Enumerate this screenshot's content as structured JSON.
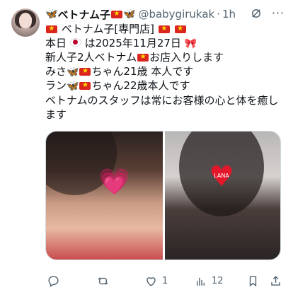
{
  "tweet": {
    "display_name": "ベトナム子",
    "handle": "@babygirukak",
    "separator": "·",
    "time": "1h",
    "lines": [
      "ベトナム子[専門店]",
      "本日",
      "は2025年11月27日",
      "新人子2人ベトナム",
      "お店入りします",
      "みさ",
      "ちゃん21歳 本人です",
      "ラン",
      "ちゃん22歳本人です",
      "ベトナムのスタッフは常にお客様の心と体を癒します"
    ],
    "heart_label": "LANA"
  },
  "actions": {
    "reply_count": "",
    "retweet_count": "",
    "like_count": "1",
    "views_count": "12"
  },
  "icons": {
    "grok": "grok-icon",
    "more": "more-icon",
    "reply": "reply-icon",
    "retweet": "retweet-icon",
    "like": "like-icon",
    "views": "views-icon",
    "bookmark": "bookmark-icon",
    "share": "share-icon"
  },
  "colors": {
    "text": "#0f1419",
    "muted": "#536471",
    "flag_red": "#da251d",
    "flag_star": "#ffdd00",
    "butterfly": "#2a9df4"
  }
}
